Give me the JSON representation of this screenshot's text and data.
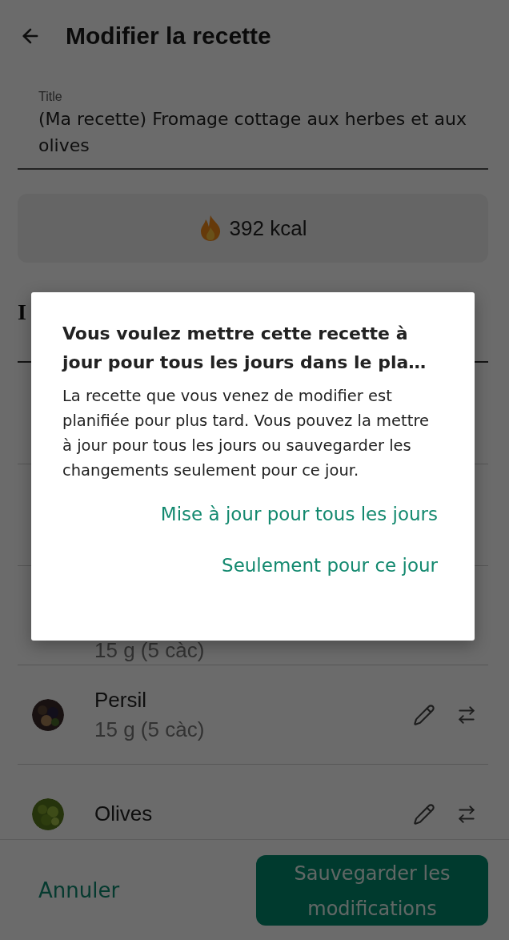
{
  "header": {
    "title": "Modifier la recette"
  },
  "title_field": {
    "label": "Title",
    "value": "(Ma recette) Fromage cottage aux herbes et aux olives"
  },
  "calories": {
    "text": "392 kcal"
  },
  "ingredients_heading": "I",
  "ingredients": [
    {
      "amount": "15 g (5 càc)"
    },
    {
      "name": "Persil",
      "amount": "15 g (5 càc)"
    },
    {
      "name": "Olives"
    }
  ],
  "footer": {
    "cancel": "Annuler",
    "save": "Sauvegarder les modifications"
  },
  "dialog": {
    "title": "Vous voulez mettre cette recette à jour pour tous les jours dans le pla…",
    "body": "La recette que vous venez de modifier est planifiée pour plus tard. Vous pouvez la mettre à jour pour tous les jours ou sauvegarder les changements seulement pour ce jour.",
    "actions": [
      "Mise à jour pour tous les jours",
      "Seulement pour ce jour"
    ]
  }
}
